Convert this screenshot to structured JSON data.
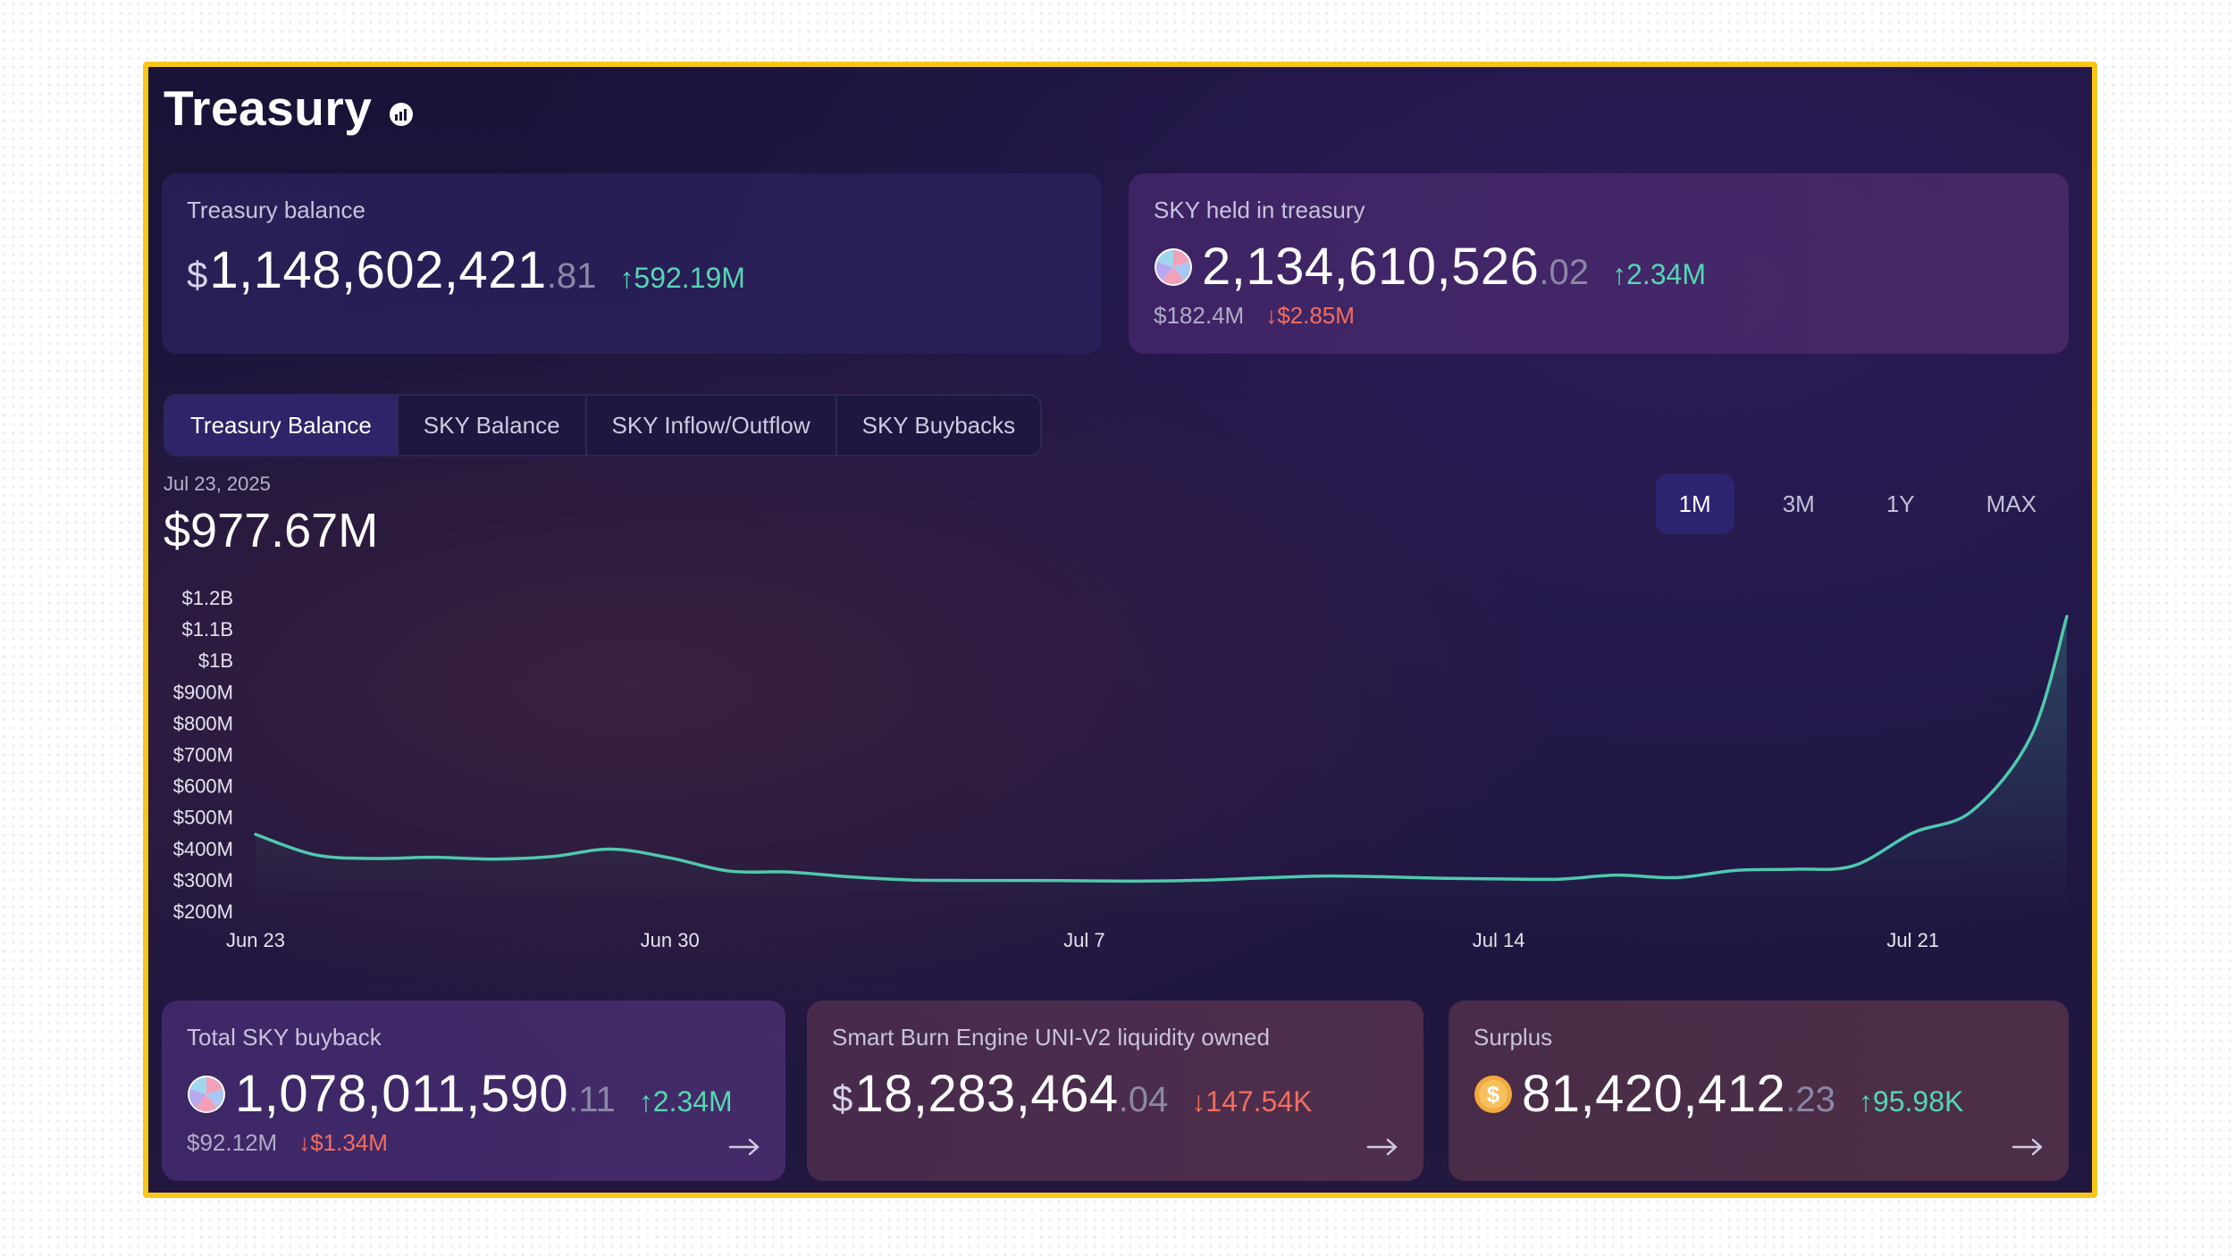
{
  "title": "Treasury",
  "title_icon": "chart-info-icon",
  "top_cards": {
    "treasury_balance": {
      "label": "Treasury balance",
      "currency": "$",
      "value": "1,148,602,421",
      "decimals": ".81",
      "change": "↑592.19M"
    },
    "sky_held": {
      "label": "SKY held in treasury",
      "value": "2,134,610,526",
      "decimals": ".02",
      "change": "↑2.34M",
      "usd": "$182.4M",
      "usd_change": "↓$2.85M"
    }
  },
  "tabs": [
    "Treasury Balance",
    "SKY Balance",
    "SKY Inflow/Outflow",
    "SKY Buybacks"
  ],
  "active_tab": 0,
  "chart_header": {
    "date": "Jul 23, 2025",
    "value": "$977.67M"
  },
  "ranges": [
    "1M",
    "3M",
    "1Y",
    "MAX"
  ],
  "active_range": 0,
  "bottom_cards": {
    "buyback": {
      "label": "Total SKY buyback",
      "value": "1,078,011,590",
      "decimals": ".11",
      "change": "↑2.34M",
      "usd": "$92.12M",
      "usd_change": "↓$1.34M"
    },
    "smart_burn": {
      "label": "Smart Burn Engine UNI-V2 liquidity owned",
      "currency": "$",
      "value": "18,283,464",
      "decimals": ".04",
      "change": "↓147.54K"
    },
    "surplus": {
      "label": "Surplus",
      "value": "81,420,412",
      "decimals": ".23",
      "change": "↑95.98K"
    }
  },
  "colors": {
    "accent_line": "#4fc9ad",
    "positive": "#56d6b3",
    "negative": "#f26d5e",
    "frame": "#f6c619",
    "active_tab": "#2d246a"
  },
  "chart_data": {
    "type": "area",
    "title": "",
    "xlabel": "",
    "ylabel": "",
    "y_tick_labels": [
      "$1.2B",
      "$1.1B",
      "$1B",
      "$900M",
      "$800M",
      "$700M",
      "$600M",
      "$500M",
      "$400M",
      "$300M",
      "$200M"
    ],
    "x_tick_labels": [
      "Jun 23",
      "Jun 30",
      "Jul 7",
      "Jul 14",
      "Jul 21"
    ],
    "ylim": [
      200,
      1200
    ],
    "xlim": [
      0,
      30.6
    ],
    "x_ticks": [
      0,
      7,
      14,
      21,
      28
    ],
    "y_unit": "$M",
    "grid": false,
    "series": [
      {
        "x": [
          0,
          1,
          2,
          3,
          4,
          5,
          6,
          7,
          8,
          9,
          10,
          11,
          12,
          13,
          14,
          15,
          16,
          17,
          18,
          19,
          20,
          21,
          22,
          23,
          24,
          25,
          26,
          27,
          28,
          29,
          30,
          30.6
        ],
        "values": [
          445,
          380,
          368,
          372,
          366,
          374,
          398,
          370,
          328,
          325,
          310,
          300,
          298,
          298,
          297,
          296,
          299,
          306,
          312,
          310,
          305,
          303,
          302,
          315,
          307,
          330,
          334,
          345,
          450,
          520,
          760,
          1140
        ]
      }
    ]
  }
}
